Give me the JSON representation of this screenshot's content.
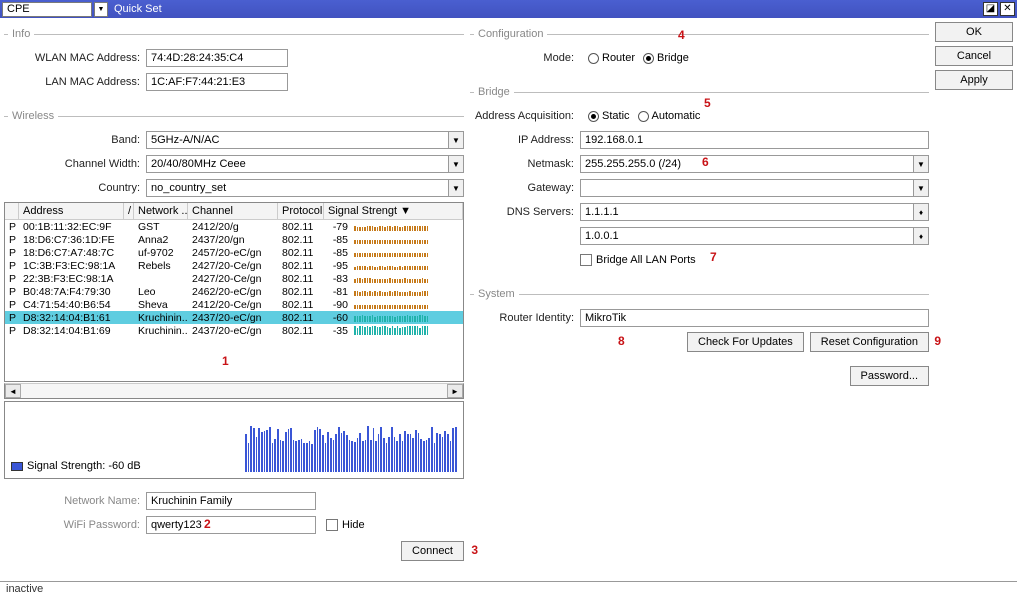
{
  "titlebar": {
    "dropdown_value": "CPE",
    "title": "Quick Set"
  },
  "buttons": {
    "ok": "OK",
    "cancel": "Cancel",
    "apply": "Apply",
    "connect": "Connect",
    "check_updates": "Check For Updates",
    "reset_config": "Reset Configuration",
    "password": "Password..."
  },
  "info": {
    "legend": "Info",
    "wlan_label": "WLAN MAC Address:",
    "wlan_value": "74:4D:28:24:35:C4",
    "lan_label": "LAN MAC Address:",
    "lan_value": "1C:AF:F7:44:21:E3"
  },
  "wireless": {
    "legend": "Wireless",
    "band_label": "Band:",
    "band_value": "5GHz-A/N/AC",
    "chwidth_label": "Channel Width:",
    "chwidth_value": "20/40/80MHz Ceee",
    "country_label": "Country:",
    "country_value": "no_country_set",
    "columns": [
      "",
      "Address",
      "Network ...",
      "Channel",
      "Protocol",
      "Signal Strengt ▼"
    ],
    "rows": [
      {
        "ind": "P",
        "addr": "00:1B:11:32:EC:9F",
        "net": "GST",
        "chan": "2412/20/g",
        "prot": "802.11",
        "sig": "-79",
        "sel": false
      },
      {
        "ind": "P",
        "addr": "18:D6:C7:36:1D:FE",
        "net": "Anna2",
        "chan": "2437/20/gn",
        "prot": "802.11",
        "sig": "-85",
        "sel": false
      },
      {
        "ind": "P",
        "addr": "18:D6:C7:A7:48:7C",
        "net": "uf-9702",
        "chan": "2457/20-eC/gn",
        "prot": "802.11",
        "sig": "-85",
        "sel": false
      },
      {
        "ind": "P",
        "addr": "1C:3B:F3:EC:98:1A",
        "net": "Rebels",
        "chan": "2427/20-Ce/gn",
        "prot": "802.11",
        "sig": "-95",
        "sel": false
      },
      {
        "ind": "P",
        "addr": "22:3B:F3:EC:98:1A",
        "net": "",
        "chan": "2427/20-Ce/gn",
        "prot": "802.11",
        "sig": "-83",
        "sel": false
      },
      {
        "ind": "P",
        "addr": "B0:48:7A:F4:79:30",
        "net": "Leo",
        "chan": "2462/20-eC/gn",
        "prot": "802.11",
        "sig": "-81",
        "sel": false
      },
      {
        "ind": "P",
        "addr": "C4:71:54:40:B6:54",
        "net": "Sheva",
        "chan": "2412/20-Ce/gn",
        "prot": "802.11",
        "sig": "-90",
        "sel": false
      },
      {
        "ind": "P",
        "addr": "D8:32:14:04:B1:61",
        "net": "Kruchinin...",
        "chan": "2437/20-eC/gn",
        "prot": "802.11",
        "sig": "-60",
        "sel": true
      },
      {
        "ind": "P",
        "addr": "D8:32:14:04:B1:69",
        "net": "Kruchinin...",
        "chan": "2437/20-eC/gn",
        "prot": "802.11",
        "sig": "-35",
        "sel": false
      }
    ],
    "graph_legend": "Signal Strength:  -60 dB",
    "network_name_label": "Network Name:",
    "network_name_value": "Kruchinin Family",
    "wifi_pass_label": "WiFi Password:",
    "wifi_pass_value": "qwerty123",
    "hide_label": "Hide"
  },
  "config": {
    "legend": "Configuration",
    "mode_label": "Mode:",
    "router_label": "Router",
    "bridge_label": "Bridge"
  },
  "bridge": {
    "legend": "Bridge",
    "addr_acq_label": "Address Acquisition:",
    "static_label": "Static",
    "automatic_label": "Automatic",
    "ip_label": "IP Address:",
    "ip_value": "192.168.0.1",
    "netmask_label": "Netmask:",
    "netmask_value": "255.255.255.0 (/24)",
    "gateway_label": "Gateway:",
    "gateway_value": "",
    "dns_label": "DNS Servers:",
    "dns1_value": "1.1.1.1",
    "dns2_value": "1.0.0.1",
    "bridge_all_label": "Bridge All LAN Ports"
  },
  "system": {
    "legend": "System",
    "identity_label": "Router Identity:",
    "identity_value": "MikroTik"
  },
  "status": "inactive",
  "annotations": {
    "a1": "1",
    "a2": "2",
    "a3": "3",
    "a4": "4",
    "a5": "5",
    "a6": "6",
    "a7": "7",
    "a8": "8",
    "a9": "9"
  }
}
